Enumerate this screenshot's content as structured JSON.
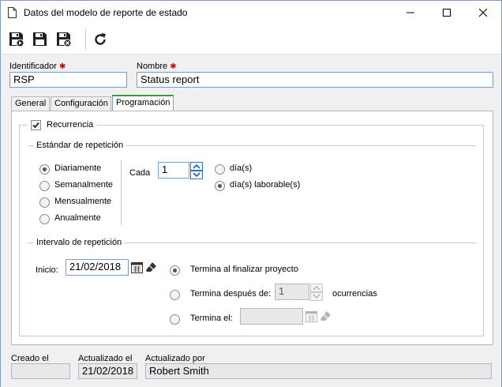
{
  "window": {
    "title": "Datos del modelo de reporte de estado"
  },
  "fields": {
    "identificador_label": "Identificador",
    "identificador_value": "RSP",
    "nombre_label": "Nombre",
    "nombre_value": "Status report",
    "required_mark": "✱"
  },
  "tabs": [
    {
      "label": "General"
    },
    {
      "label": "Configuración"
    },
    {
      "label": "Programación"
    }
  ],
  "programacion": {
    "recurrencia_label": "Recurrencia",
    "recurrencia_checked": true,
    "estandar_title": "Estándar de repetición",
    "frequency": [
      {
        "label": "Diariamente",
        "selected": true
      },
      {
        "label": "Semanalmente",
        "selected": false
      },
      {
        "label": "Mensualmente",
        "selected": false
      },
      {
        "label": "Anualmente",
        "selected": false
      }
    ],
    "cada_label": "Cada",
    "cada_value": "1",
    "day_type": [
      {
        "label": "día(s)",
        "selected": false
      },
      {
        "label": "día(s) laborable(s)",
        "selected": true
      }
    ],
    "intervalo_title": "Intervalo de repetición",
    "inicio_label": "Inicio:",
    "inicio_value": "21/02/2018",
    "end_options": [
      {
        "label": "Termina al finalizar proyecto",
        "selected": true
      },
      {
        "label": "Termina después de:",
        "selected": false
      },
      {
        "label": "Termina el:",
        "selected": false
      }
    ],
    "ocurrencias_value": "1",
    "ocurrencias_label": "ocurrencias",
    "termina_el_value": ""
  },
  "footer": {
    "creado_label": "Creado el",
    "creado_value": "",
    "actualizado_label": "Actualizado el",
    "actualizado_value": "21/02/2018",
    "actualizado_por_label": "Actualizado por",
    "actualizado_por_value": "Robert Smith"
  }
}
